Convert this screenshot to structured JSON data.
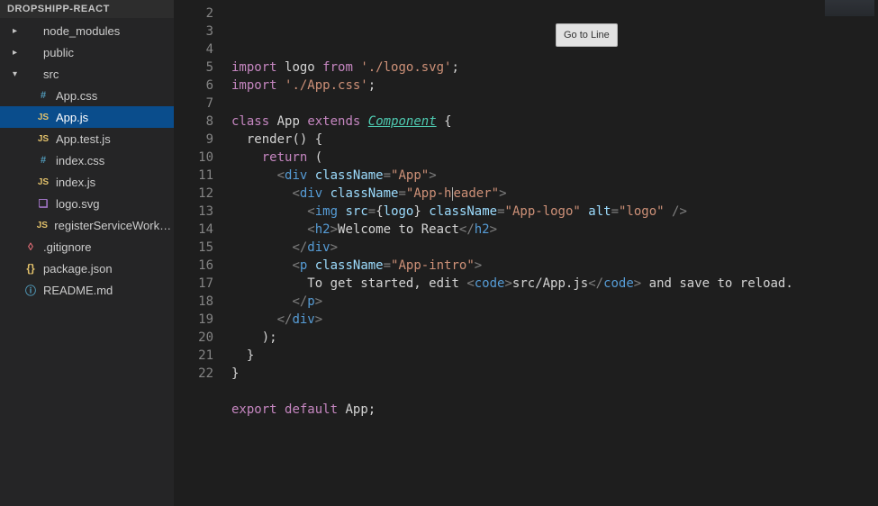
{
  "sidebar": {
    "sectionHeader": "DROPSHIPP-REACT",
    "items": [
      {
        "label": "node_modules",
        "icon": "folder",
        "depth": 1,
        "twisty": "▸"
      },
      {
        "label": "public",
        "icon": "folder",
        "depth": 1,
        "twisty": "▸"
      },
      {
        "label": "src",
        "icon": "folder",
        "depth": 1,
        "twisty": "▾"
      },
      {
        "label": "App.css",
        "icon": "css",
        "depth": 2
      },
      {
        "label": "App.js",
        "icon": "js",
        "depth": 2,
        "selected": true
      },
      {
        "label": "App.test.js",
        "icon": "js",
        "depth": 2
      },
      {
        "label": "index.css",
        "icon": "css",
        "depth": 2
      },
      {
        "label": "index.js",
        "icon": "js",
        "depth": 2
      },
      {
        "label": "logo.svg",
        "icon": "svg",
        "depth": 2
      },
      {
        "label": "registerServiceWorker....",
        "icon": "js",
        "depth": 2
      },
      {
        "label": ".gitignore",
        "icon": "git",
        "depth": 1
      },
      {
        "label": "package.json",
        "icon": "json",
        "depth": 1
      },
      {
        "label": "README.md",
        "icon": "md",
        "depth": 1
      }
    ]
  },
  "tooltip": "Go to Line",
  "editor": {
    "lineStart": 2,
    "lineEnd": 22,
    "lines": [
      {
        "n": 2,
        "tokens": [
          [
            "kw",
            "import"
          ],
          [
            "punc",
            " "
          ],
          [
            "var",
            "logo"
          ],
          [
            "punc",
            " "
          ],
          [
            "from",
            "from"
          ],
          [
            "punc",
            " "
          ],
          [
            "str",
            "'./logo.svg'"
          ],
          [
            "punc",
            ";"
          ]
        ]
      },
      {
        "n": 3,
        "tokens": [
          [
            "kw",
            "import"
          ],
          [
            "punc",
            " "
          ],
          [
            "str",
            "'./App.css'"
          ],
          [
            "punc",
            ";"
          ]
        ]
      },
      {
        "n": 4,
        "tokens": []
      },
      {
        "n": 5,
        "tokens": [
          [
            "kw",
            "class"
          ],
          [
            "punc",
            " "
          ],
          [
            "var",
            "App"
          ],
          [
            "punc",
            " "
          ],
          [
            "kw",
            "extends"
          ],
          [
            "punc",
            " "
          ],
          [
            "comp",
            "Component"
          ],
          [
            "punc",
            " {"
          ]
        ]
      },
      {
        "n": 6,
        "tokens": [
          [
            "punc",
            "  "
          ],
          [
            "var",
            "render"
          ],
          [
            "punc",
            "() {"
          ]
        ]
      },
      {
        "n": 7,
        "tokens": [
          [
            "punc",
            "    "
          ],
          [
            "kw",
            "return"
          ],
          [
            "punc",
            " ("
          ]
        ]
      },
      {
        "n": 8,
        "tokens": [
          [
            "punc",
            "      "
          ],
          [
            "tagb",
            "<"
          ],
          [
            "tag",
            "div"
          ],
          [
            "punc",
            " "
          ],
          [
            "attr",
            "className"
          ],
          [
            "tagb",
            "="
          ],
          [
            "attrval",
            "\"App\""
          ],
          [
            "tagb",
            ">"
          ]
        ]
      },
      {
        "n": 9,
        "tokens": [
          [
            "punc",
            "        "
          ],
          [
            "tagb",
            "<"
          ],
          [
            "tag",
            "div"
          ],
          [
            "punc",
            " "
          ],
          [
            "attr",
            "className"
          ],
          [
            "tagb",
            "="
          ],
          [
            "attrval",
            "\"App-h"
          ],
          [
            "cursor",
            ""
          ],
          [
            "attrval",
            "eader\""
          ],
          [
            "tagb",
            ">"
          ]
        ]
      },
      {
        "n": 10,
        "tokens": [
          [
            "punc",
            "          "
          ],
          [
            "tagb",
            "<"
          ],
          [
            "tag",
            "img"
          ],
          [
            "punc",
            " "
          ],
          [
            "attr",
            "src"
          ],
          [
            "tagb",
            "="
          ],
          [
            "brace",
            "{"
          ],
          [
            "logo",
            "logo"
          ],
          [
            "brace",
            "}"
          ],
          [
            "punc",
            " "
          ],
          [
            "attr",
            "className"
          ],
          [
            "tagb",
            "="
          ],
          [
            "attrval",
            "\"App-logo\""
          ],
          [
            "punc",
            " "
          ],
          [
            "attr",
            "alt"
          ],
          [
            "tagb",
            "="
          ],
          [
            "attrval",
            "\"logo\""
          ],
          [
            "punc",
            " "
          ],
          [
            "tagb",
            "/>"
          ]
        ]
      },
      {
        "n": 11,
        "tokens": [
          [
            "punc",
            "          "
          ],
          [
            "tagb",
            "<"
          ],
          [
            "tag",
            "h2"
          ],
          [
            "tagb",
            ">"
          ],
          [
            "var",
            "Welcome to React"
          ],
          [
            "tagb",
            "</"
          ],
          [
            "tag",
            "h2"
          ],
          [
            "tagb",
            ">"
          ]
        ]
      },
      {
        "n": 12,
        "tokens": [
          [
            "punc",
            "        "
          ],
          [
            "tagb",
            "</"
          ],
          [
            "tag",
            "div"
          ],
          [
            "tagb",
            ">"
          ]
        ]
      },
      {
        "n": 13,
        "tokens": [
          [
            "punc",
            "        "
          ],
          [
            "tagb",
            "<"
          ],
          [
            "tag",
            "p"
          ],
          [
            "punc",
            " "
          ],
          [
            "attr",
            "className"
          ],
          [
            "tagb",
            "="
          ],
          [
            "attrval",
            "\"App-intro\""
          ],
          [
            "tagb",
            ">"
          ]
        ]
      },
      {
        "n": 14,
        "tokens": [
          [
            "punc",
            "          "
          ],
          [
            "var",
            "To get started, edit "
          ],
          [
            "tagb",
            "<"
          ],
          [
            "tag",
            "code"
          ],
          [
            "tagb",
            ">"
          ],
          [
            "var",
            "src/App.js"
          ],
          [
            "tagb",
            "</"
          ],
          [
            "tag",
            "code"
          ],
          [
            "tagb",
            ">"
          ],
          [
            "var",
            " and save to reload."
          ]
        ]
      },
      {
        "n": 15,
        "tokens": [
          [
            "punc",
            "        "
          ],
          [
            "tagb",
            "</"
          ],
          [
            "tag",
            "p"
          ],
          [
            "tagb",
            ">"
          ]
        ]
      },
      {
        "n": 16,
        "tokens": [
          [
            "punc",
            "      "
          ],
          [
            "tagb",
            "</"
          ],
          [
            "tag",
            "div"
          ],
          [
            "tagb",
            ">"
          ]
        ]
      },
      {
        "n": 17,
        "tokens": [
          [
            "punc",
            "    );"
          ]
        ]
      },
      {
        "n": 18,
        "tokens": [
          [
            "punc",
            "  }"
          ]
        ]
      },
      {
        "n": 19,
        "tokens": [
          [
            "punc",
            "}"
          ]
        ]
      },
      {
        "n": 20,
        "tokens": []
      },
      {
        "n": 21,
        "tokens": [
          [
            "kw",
            "export"
          ],
          [
            "punc",
            " "
          ],
          [
            "kw",
            "default"
          ],
          [
            "punc",
            " "
          ],
          [
            "var",
            "App"
          ],
          [
            "punc",
            ";"
          ]
        ]
      },
      {
        "n": 22,
        "tokens": []
      }
    ]
  },
  "icons": {
    "folder": "",
    "js": "JS",
    "css": "#",
    "svg": "❏",
    "json": "{}",
    "git": "◊",
    "md": "ⓘ"
  }
}
